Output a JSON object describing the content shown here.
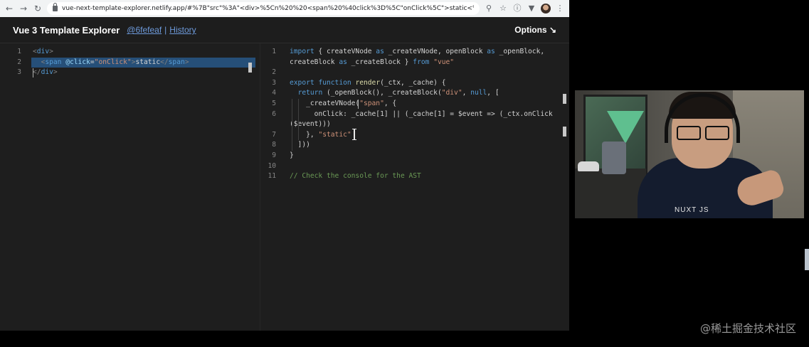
{
  "browser": {
    "url": "vue-next-template-explorer.netlify.app/#%7B\"src\"%3A\"<div>%5Cn%20%20<span%20%40click%3D%5C\"onClick%5C\">static<%2Fspan>%5Cn<%2Fdiv>\"%2C\"...",
    "icons": [
      "back-icon",
      "forward-icon",
      "reload-icon",
      "lock-icon",
      "search-icon",
      "star-icon",
      "info-icon",
      "extension-icon",
      "profile-avatar",
      "menu-icon"
    ]
  },
  "app": {
    "title": "Vue 3 Template Explorer",
    "commit": "@6fefeaf",
    "separator": "|",
    "history": "History",
    "options": "Options ↘"
  },
  "left_editor": {
    "lines": [
      {
        "n": "1",
        "parts": [
          {
            "c": "t-tag",
            "t": "<"
          },
          {
            "c": "t-tagname",
            "t": "div"
          },
          {
            "c": "t-tag",
            "t": ">"
          }
        ]
      },
      {
        "n": "2",
        "parts": [
          {
            "c": "t-var",
            "t": "  "
          },
          {
            "c": "t-tag",
            "t": "<"
          },
          {
            "c": "t-tagname",
            "t": "span"
          },
          {
            "c": "t-var",
            "t": " "
          },
          {
            "c": "t-attr",
            "t": "@click"
          },
          {
            "c": "t-var",
            "t": "="
          },
          {
            "c": "t-str",
            "t": "\"onClick\""
          },
          {
            "c": "t-tag",
            "t": ">"
          },
          {
            "c": "t-var",
            "t": "static"
          },
          {
            "c": "t-tag",
            "t": "</"
          },
          {
            "c": "t-tagname",
            "t": "span"
          },
          {
            "c": "t-tag",
            "t": ">"
          }
        ]
      },
      {
        "n": "3",
        "parts": [
          {
            "c": "t-tag",
            "t": "</"
          },
          {
            "c": "t-tagname",
            "t": "div"
          },
          {
            "c": "t-tag",
            "t": ">"
          }
        ]
      }
    ]
  },
  "right_editor": {
    "lines": [
      {
        "n": "1",
        "parts": [
          {
            "c": "t-kw",
            "t": "import"
          },
          {
            "c": "t-var",
            "t": " { createVNode "
          },
          {
            "c": "t-kw",
            "t": "as"
          },
          {
            "c": "t-var",
            "t": " _createVNode, openBlock "
          },
          {
            "c": "t-kw",
            "t": "as"
          },
          {
            "c": "t-var",
            "t": " _openBlock,"
          }
        ]
      },
      {
        "n": "",
        "parts": [
          {
            "c": "t-var",
            "t": "createBlock "
          },
          {
            "c": "t-kw",
            "t": "as"
          },
          {
            "c": "t-var",
            "t": " _createBlock } "
          },
          {
            "c": "t-kw",
            "t": "from"
          },
          {
            "c": "t-var",
            "t": " "
          },
          {
            "c": "t-str",
            "t": "\"vue\""
          }
        ]
      },
      {
        "n": "2",
        "parts": []
      },
      {
        "n": "3",
        "parts": [
          {
            "c": "t-kw",
            "t": "export"
          },
          {
            "c": "t-var",
            "t": " "
          },
          {
            "c": "t-kw",
            "t": "function"
          },
          {
            "c": "t-var",
            "t": " "
          },
          {
            "c": "t-fn",
            "t": "render"
          },
          {
            "c": "t-var",
            "t": "(_ctx, _cache) {"
          }
        ]
      },
      {
        "n": "4",
        "parts": [
          {
            "c": "t-var",
            "t": "  "
          },
          {
            "c": "t-kw",
            "t": "return"
          },
          {
            "c": "t-var",
            "t": " (_openBlock(), _createBlock("
          },
          {
            "c": "t-str",
            "t": "\"div\""
          },
          {
            "c": "t-var",
            "t": ", "
          },
          {
            "c": "t-kw",
            "t": "null"
          },
          {
            "c": "t-var",
            "t": ", ["
          }
        ]
      },
      {
        "n": "5",
        "parts": [
          {
            "c": "t-var",
            "t": "    _createVNode("
          },
          {
            "c": "t-str",
            "t": "\"span\""
          },
          {
            "c": "t-var",
            "t": ", {"
          }
        ]
      },
      {
        "n": "6",
        "parts": [
          {
            "c": "t-var",
            "t": "      onClick: _cache[1] || (_cache[1] = $event => (_ctx.onClick"
          }
        ]
      },
      {
        "n": "",
        "parts": [
          {
            "c": "t-var",
            "t": "($event)))"
          }
        ]
      },
      {
        "n": "7",
        "parts": [
          {
            "c": "t-var",
            "t": "    }, "
          },
          {
            "c": "t-str",
            "t": "\"static\""
          }
        ]
      },
      {
        "n": "8",
        "parts": [
          {
            "c": "t-var",
            "t": "  ]))"
          }
        ]
      },
      {
        "n": "9",
        "parts": [
          {
            "c": "t-var",
            "t": "}"
          }
        ]
      },
      {
        "n": "10",
        "parts": []
      },
      {
        "n": "11",
        "parts": [
          {
            "c": "t-comment",
            "t": "// Check the console for the AST"
          }
        ]
      }
    ]
  },
  "webcam": {
    "shirt_logo": "NUXT JS"
  },
  "watermark": "@稀土掘金技术社区"
}
